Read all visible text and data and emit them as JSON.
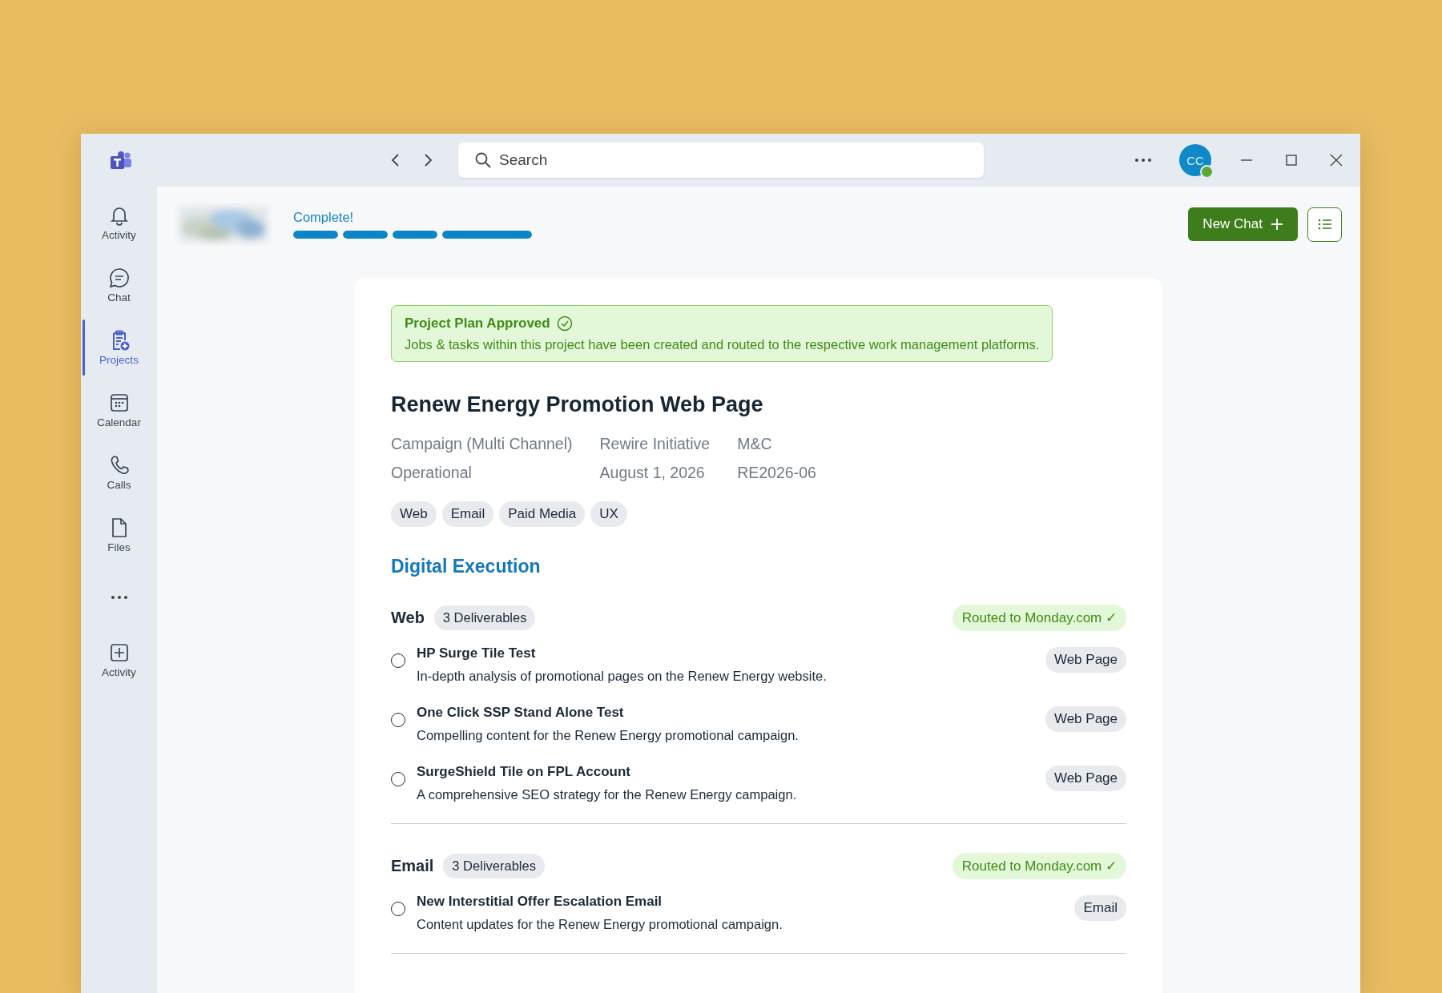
{
  "search": {
    "placeholder": "Search"
  },
  "avatar": {
    "initials": "CC"
  },
  "sidebar": {
    "items": [
      {
        "kind": "app",
        "label": "Activity",
        "selected": false
      },
      {
        "kind": "app",
        "label": "Chat",
        "selected": false
      },
      {
        "kind": "app",
        "label": "Projects",
        "selected": true
      },
      {
        "kind": "app",
        "label": "Calendar",
        "selected": false
      },
      {
        "kind": "app",
        "label": "Calls",
        "selected": false
      },
      {
        "kind": "app",
        "label": "Files",
        "selected": false
      },
      {
        "kind": "more"
      },
      {
        "kind": "app",
        "label": "Activity",
        "selected": false
      }
    ]
  },
  "progress": {
    "label": "Complete!",
    "segments": [
      {
        "level": 1
      },
      {
        "level": 1
      },
      {
        "level": 1
      },
      {
        "level": 1
      }
    ]
  },
  "new_chat_button": {
    "label": "New Chat"
  },
  "banner": {
    "title": "Project Plan Approved",
    "text": "Jobs & tasks within this project have been created and routed to the respective work management platforms."
  },
  "project": {
    "title": "Renew Energy Promotion Web Page",
    "meta": [
      [
        "Campaign (Multi Channel)",
        "Rewire Initiative",
        "M&C"
      ],
      [
        "Operational",
        "August 1, 2026",
        "RE2026-06"
      ]
    ],
    "tags": [
      "Web",
      "Email",
      "Paid Media",
      "UX"
    ]
  },
  "section_title": "Digital Execution",
  "groups": [
    {
      "name": "Web",
      "count": "3 Deliverables",
      "status": "Routed to Monday.com ✓",
      "items": [
        {
          "title": "HP Surge Tile Test",
          "description": "In-depth analysis of promotional pages on the Renew Energy website.",
          "type": "Web Page",
          "checked": false
        },
        {
          "title": "One Click SSP Stand Alone Test",
          "description": "Compelling content for the Renew Energy promotional campaign.",
          "type": "Web Page",
          "checked": false
        },
        {
          "title": "SurgeShield Tile on FPL Account",
          "description": "A comprehensive SEO strategy for the Renew Energy campaign.",
          "type": "Web Page",
          "checked": false
        }
      ]
    },
    {
      "name": "Email",
      "count": "3 Deliverables",
      "status": "Routed to Monday.com ✓",
      "items": [
        {
          "title": "New Interstitial Offer Escalation Email",
          "description": "Content updates for the Renew Energy promotional campaign.",
          "type": "Email",
          "checked": false
        }
      ]
    }
  ]
}
